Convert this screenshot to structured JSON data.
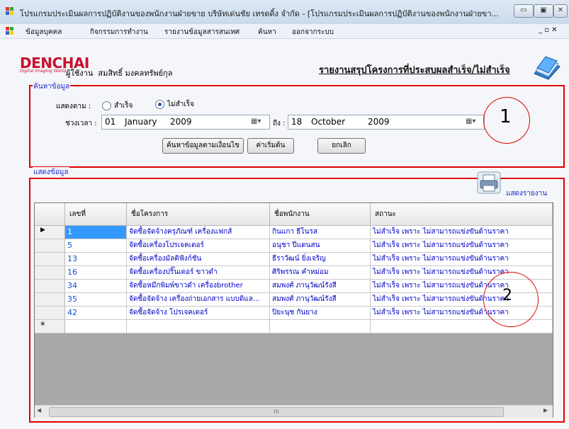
{
  "window": {
    "title": "โปรแกรมประเมินผลการปฏิบัติงานของพนักงานฝ่ายขาย บริษัทเด่นชัย เทรดดิ้ง จำกัด - [โปรแกรมประเมินผลการปฏิบัติงานของพนักงานฝ่ายขา...",
    "min": "▭",
    "max": "▣",
    "close": "✕"
  },
  "menu": {
    "items": [
      "ข้อมูลบุคคล",
      "กิจกรรมการทำงาน",
      "รายงานข้อมูลสารสนเทศ",
      "ค้นหา",
      "ออกจากระบบ"
    ],
    "right_controls": "_ ▫ ✕"
  },
  "header": {
    "logo": "DENCHAI",
    "logo_sub": "Digital Imaging World",
    "user_label": "ผู้ใช้งาน",
    "user_name": "สมสิทธิ์ มงคลทรัพย์กุล",
    "report_title": "รายงานสรุปโครงการที่ประสบผลสำเร็จ/ไม่สำเร็จ"
  },
  "search": {
    "group_label": "ค้นหาข้อมูล",
    "show_by_label": "แสดงตาม :",
    "radio_success": "สำเร็จ",
    "radio_fail": "ไม่สำเร็จ",
    "selected": "fail",
    "period_label": "ช่วงเวลา :",
    "date_from": {
      "day": "01",
      "month": "January",
      "year": "2009"
    },
    "to_label": "ถึง :",
    "date_to": {
      "day": "18",
      "month": "October",
      "year": "2009"
    },
    "btn_search": "ค้นหาข้อมูลตามเงื่อนไข",
    "btn_default": "ค่าเริ่มต้น",
    "btn_cancel": "ยกเลิก",
    "annotation": "1"
  },
  "results": {
    "group_label": "แสดงข้อมูล",
    "print_label": "แสดงรายงาน",
    "annotation": "2",
    "columns": [
      "เลขที่",
      "ชื่อโครงการ",
      "ชื่อพนักงาน",
      "สถานะ"
    ],
    "rows": [
      [
        "1",
        "จัดซื้อจัดจ้างครุภัณฑ์ เครื่องแฟกส์",
        "กินแกา ธีโนรส",
        "ไม่สำเร็จ เพราะ ไม่สามารถแข่งขันด้านราคา"
      ],
      [
        "5",
        "จัดซื้อเครื่องโปรเจคเตอร์",
        "อนุชา ปีแดนสน",
        "ไม่สำเร็จ เพราะ ไม่สามารถแข่งขันด้านราคา"
      ],
      [
        "13",
        "จัดซื้อเครื่องมัลติฟังก์ชัน",
        "ธีราวัฒน์ ยิ่งเจริญ",
        "ไม่สำเร็จ เพราะ ไม่สามารถแข่งขันด้านราคา"
      ],
      [
        "16",
        "จัดซื้อเครื่องปริ๊นเตอร์ ขาวดำ",
        "ศิริพรรณ คำหม่อม",
        "ไม่สำเร็จ เพราะ ไม่สามารถแข่งขันด้านราคา"
      ],
      [
        "34",
        "จัดซื้อหมึกพิมพ์ขาวดำ เครื่องbrother",
        "สมพงศ์ ภานุวัฒน์รังสี",
        "ไม่สำเร็จ เพราะ ไม่สามารถแข่งขันด้านราคา"
      ],
      [
        "35",
        "จัดซื้อจัดจ้าง เครื่องถ่ายเอกสาร แบบดิแล...",
        "สมพงศ์ ภานุวัฒน์รังสี",
        "ไม่สำเร็จ เพราะ ไม่สามารถแข่งขันด้านราคา"
      ],
      [
        "42",
        "จัดซื้อจัดจ้าง โปรเจคเตอร์",
        "ปิยะนุช กันยาง",
        "ไม่สำเร็จ เพราะ ไม่สามารถแข่งขันด้านราคา"
      ]
    ],
    "new_row_marker": "*",
    "current_row_marker": "▶",
    "hscroll_thumb": "III",
    "hscroll_left": "◀",
    "hscroll_right": "▶"
  }
}
